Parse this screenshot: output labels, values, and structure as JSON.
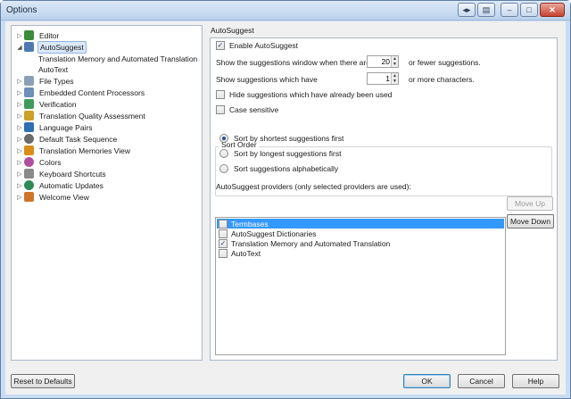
{
  "window": {
    "title": "Options"
  },
  "tree": {
    "items": [
      {
        "label": "Editor",
        "icon": "pencil-icon",
        "color": "#3a8c3a"
      },
      {
        "label": "AutoSuggest",
        "icon": "autosuggest-icon",
        "color": "#4d78b3"
      },
      {
        "label": "Translation Memory and Automated Translation"
      },
      {
        "label": "AutoText"
      },
      {
        "label": "File Types",
        "icon": "file-types-icon",
        "color": "#8aa0b8"
      },
      {
        "label": "Embedded Content Processors",
        "icon": "embedded-content-icon",
        "color": "#6d8fb8"
      },
      {
        "label": "Verification",
        "icon": "verification-icon",
        "color": "#3f9b5a"
      },
      {
        "label": "Translation Quality Assessment",
        "icon": "quality-icon",
        "color": "#c9a227"
      },
      {
        "label": "Language Pairs",
        "icon": "language-pairs-icon",
        "color": "#2f6fb3"
      },
      {
        "label": "Default Task Sequence",
        "icon": "gear-icon",
        "color": "#6b6b6b"
      },
      {
        "label": "Translation Memories View",
        "icon": "tm-view-icon",
        "color": "#d98e1a"
      },
      {
        "label": "Colors",
        "icon": "palette-icon",
        "color": "#b04fa0"
      },
      {
        "label": "Keyboard Shortcuts",
        "icon": "keyboard-icon",
        "color": "#8a8a8a"
      },
      {
        "label": "Automatic Updates",
        "icon": "globe-icon",
        "color": "#2e8b57"
      },
      {
        "label": "Welcome View",
        "icon": "home-icon",
        "color": "#d0742a"
      }
    ]
  },
  "panel": {
    "title": "AutoSuggest",
    "enable_label": "Enable AutoSuggest",
    "enable_checked": true,
    "window_prefix": "Show the suggestions window when there are",
    "window_value": "20",
    "window_suffix": "or fewer suggestions.",
    "chars_prefix": "Show suggestions which have",
    "chars_value": "1",
    "chars_suffix": "or more characters.",
    "hide_used_label": "Hide suggestions which have already been used",
    "case_sensitive_label": "Case sensitive",
    "sort_order_title": "Sort Order",
    "sort_options": [
      {
        "label": "Sort by shortest suggestions first",
        "selected": true
      },
      {
        "label": "Sort by longest suggestions first",
        "selected": false
      },
      {
        "label": "Sort suggestions alphabetically",
        "selected": false
      }
    ],
    "providers_label": "AutoSuggest providers (only selected providers are used):",
    "providers": [
      {
        "label": "Termbases",
        "checked": false,
        "selected": true
      },
      {
        "label": "AutoSuggest Dictionaries",
        "checked": false,
        "selected": false
      },
      {
        "label": "Translation Memory and Automated Translation",
        "checked": true,
        "selected": false
      },
      {
        "label": "AutoText",
        "checked": false,
        "selected": false
      }
    ],
    "move_up": "Move Up",
    "move_down": "Move Down"
  },
  "footer": {
    "reset": "Reset to Defaults",
    "ok": "OK",
    "cancel": "Cancel",
    "help": "Help"
  }
}
